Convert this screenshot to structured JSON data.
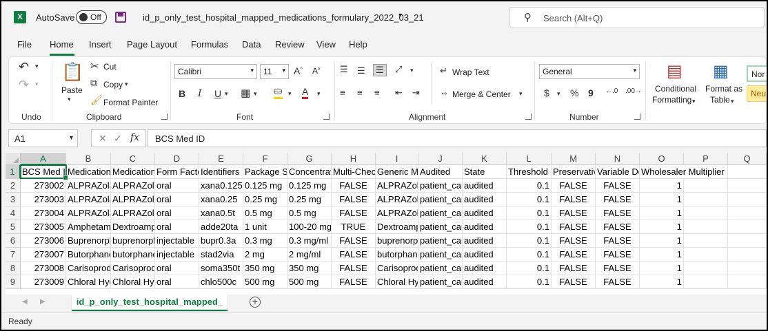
{
  "titlebar": {
    "autosave_label": "AutoSave",
    "autosave_state": "Off",
    "filename": "id_p_only_test_hospital_mapped_medications_formulary_2022_03_21",
    "search_placeholder": "Search (Alt+Q)"
  },
  "menu": [
    "File",
    "Home",
    "Insert",
    "Page Layout",
    "Formulas",
    "Data",
    "Review",
    "View",
    "Help"
  ],
  "ribbon": {
    "groups": {
      "undo": "Undo",
      "clipboard": "Clipboard",
      "font": "Font",
      "alignment": "Alignment",
      "number": "Number"
    },
    "paste": "Paste",
    "cut": "Cut",
    "copy": "Copy",
    "format_painter": "Format Painter",
    "font_name": "Calibri",
    "font_size": "11",
    "bold": "B",
    "italic": "I",
    "underline": "U",
    "wrap_text": "Wrap Text",
    "merge_center": "Merge & Center",
    "number_format": "General",
    "currency": "$",
    "percent": "%",
    "comma": "9",
    "conditional_formatting_1": "Conditional",
    "conditional_formatting_2": "Formatting",
    "format_as_table_1": "Format as",
    "format_as_table_2": "Table",
    "style_normal": "Nor",
    "style_neutral": "Neu"
  },
  "formula_bar": {
    "name_box": "A1",
    "value": "BCS Med ID"
  },
  "columns": [
    "A",
    "B",
    "C",
    "D",
    "E",
    "F",
    "G",
    "H",
    "I",
    "J",
    "K",
    "L",
    "M",
    "N",
    "O",
    "P",
    "Q"
  ],
  "header_row": [
    "BCS Med ID",
    "Medication",
    "Medication",
    "Form Factor",
    "Identifiers",
    "Package Size",
    "Concentration",
    "Multi-Check",
    "Generic Med",
    "Audited",
    "State",
    "Threshold",
    "Preservative",
    "Variable Dose",
    "Wholesaler Multiplier",
    "",
    ""
  ],
  "rows": [
    [
      "273002",
      "ALPRAZolam",
      "ALPRAZolam",
      "oral",
      "xana0.125",
      "0.125 mg",
      "0.125 mg",
      "FALSE",
      "ALPRAZolam",
      "patient_care",
      "audited",
      "0.1",
      "FALSE",
      "FALSE",
      "1"
    ],
    [
      "273003",
      "ALPRAZolam",
      "ALPRAZolam",
      "oral",
      "xana0.25",
      "0.25 mg",
      "0.25 mg",
      "FALSE",
      "ALPRAZolam",
      "patient_care",
      "audited",
      "0.1",
      "FALSE",
      "FALSE",
      "1"
    ],
    [
      "273004",
      "ALPRAZolam",
      "ALPRAZolam",
      "oral",
      "xana0.5t",
      "0.5 mg",
      "0.5 mg",
      "FALSE",
      "ALPRAZolam",
      "patient_care",
      "audited",
      "0.1",
      "FALSE",
      "FALSE",
      "1"
    ],
    [
      "273005",
      "Amphetamine",
      "Dextroamphetamine",
      "oral",
      "adde20ta",
      "1 unit",
      "100-20 mg",
      "TRUE",
      "Dextroamphetamine",
      "patient_care",
      "audited",
      "0.1",
      "FALSE",
      "FALSE",
      "1"
    ],
    [
      "273006",
      "Buprenorphine",
      "buprenorphine",
      "injectable",
      "bupr0.3a",
      "0.3 mg",
      "0.3 mg/ml",
      "FALSE",
      "buprenorphine",
      "patient_care",
      "audited",
      "0.1",
      "FALSE",
      "FALSE",
      "1"
    ],
    [
      "273007",
      "Butorphanol",
      "butorphanol",
      "injectable",
      "stad2via",
      "2 mg",
      "2 mg/ml",
      "FALSE",
      "butorphanol",
      "patient_care",
      "audited",
      "0.1",
      "FALSE",
      "FALSE",
      "1"
    ],
    [
      "273008",
      "Carisoprodol",
      "Carisoprodol",
      "oral",
      "soma350t",
      "350 mg",
      "350 mg",
      "FALSE",
      "Carisoprodol",
      "patient_care",
      "audited",
      "0.1",
      "FALSE",
      "FALSE",
      "1"
    ],
    [
      "273009",
      "Chloral Hydrate",
      "Chloral Hydrate",
      "oral",
      "chlo500c",
      "500 mg",
      "500 mg",
      "FALSE",
      "Chloral Hydrate",
      "patient_care",
      "audited",
      "0.1",
      "FALSE",
      "FALSE",
      "1"
    ]
  ],
  "row_numbers": [
    "1",
    "2",
    "3",
    "4",
    "5",
    "6",
    "7",
    "8",
    "9"
  ],
  "sheet_tab": "id_p_only_test_hospital_mapped_",
  "status": "Ready",
  "colors": {
    "accent": "#107c41"
  }
}
